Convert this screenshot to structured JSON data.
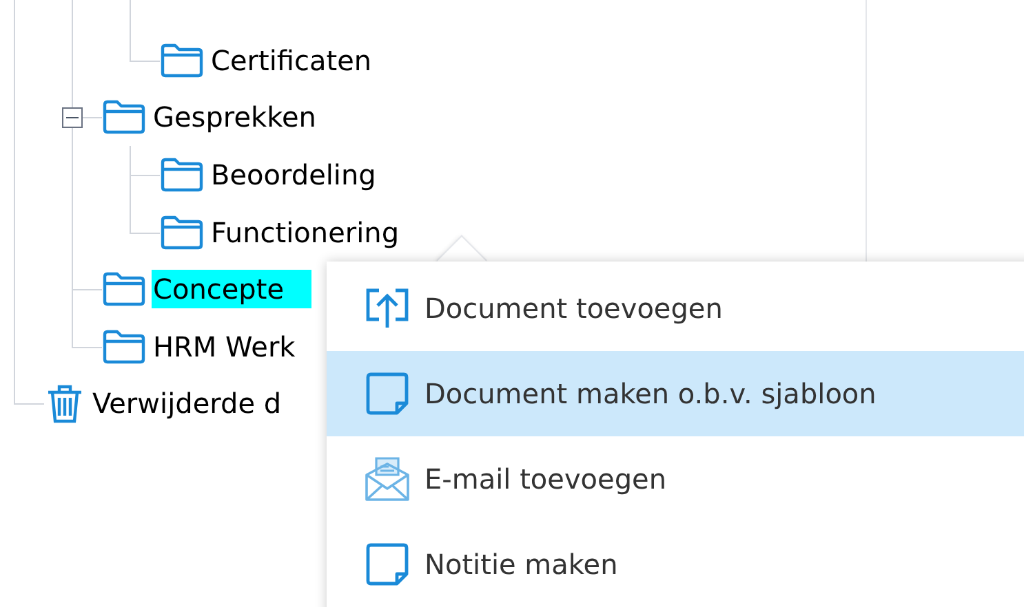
{
  "tree": {
    "children": [
      {
        "children": [
          {
            "children": [
              {
                "kind": "folder",
                "label": "Certificaten"
              }
            ]
          },
          {
            "kind": "folder",
            "label": "Gesprekken",
            "expanded": true,
            "children": [
              {
                "kind": "folder",
                "label": "Beoordeling"
              },
              {
                "kind": "folder",
                "label": "Functionering"
              }
            ]
          },
          {
            "kind": "folder",
            "label": "Concepte",
            "selected": true
          },
          {
            "kind": "folder",
            "label": "HRM Werk",
            "selected": false
          }
        ]
      },
      {
        "kind": "trash",
        "label": "Verwijderde d"
      }
    ]
  },
  "context_menu": {
    "items": [
      {
        "kind": "upload",
        "label": "Document toevoegen",
        "selected": false
      },
      {
        "kind": "note",
        "label": "Document maken o.b.v. sjabloon",
        "selected": true
      },
      {
        "kind": "email",
        "label": "E-mail toevoegen",
        "selected": false
      },
      {
        "kind": "note",
        "label": "Notitie maken",
        "selected": false
      }
    ]
  }
}
